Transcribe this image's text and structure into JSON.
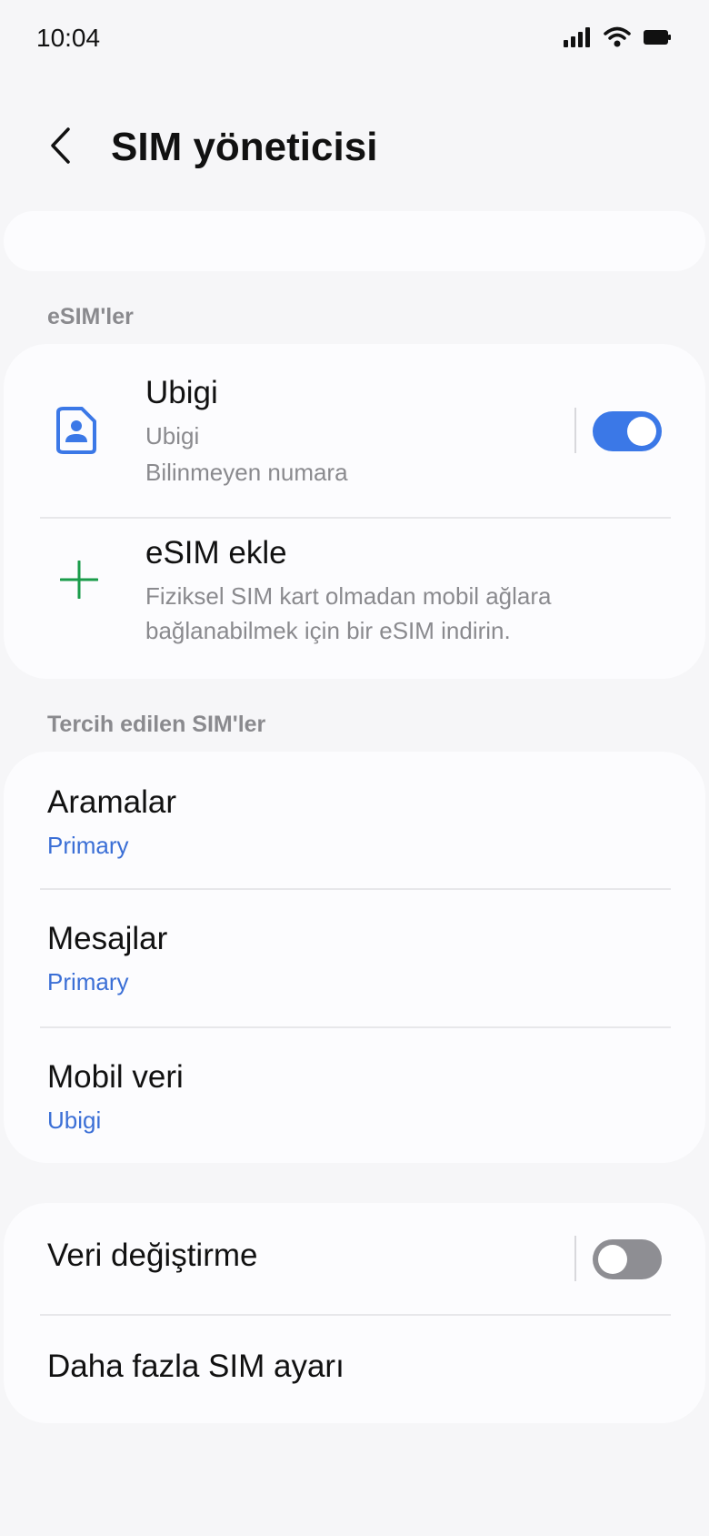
{
  "status_bar": {
    "time": "10:04",
    "icons": [
      "signal-icon",
      "wifi-icon",
      "battery-icon"
    ]
  },
  "header": {
    "title": "SIM yöneticisi",
    "back_icon": "chevron-left-icon"
  },
  "esims": {
    "section_label": "eSIM'ler",
    "items": [
      {
        "title": "Ubigi",
        "line1": "Ubigi",
        "line2": "Bilinmeyen numara",
        "icon": "sim-card-icon",
        "enabled": true
      }
    ],
    "add": {
      "title": "eSIM ekle",
      "desc_line1": "Fiziksel SIM kart olmadan mobil ağlara",
      "desc_line2": "bağlanabilmek için bir eSIM indirin.",
      "icon": "plus-icon"
    }
  },
  "preferred": {
    "section_label": "Tercih edilen SIM'ler",
    "items": [
      {
        "title": "Aramalar",
        "value": "Primary"
      },
      {
        "title": "Mesajlar",
        "value": "Primary"
      },
      {
        "title": "Mobil veri",
        "value": "Ubigi"
      }
    ]
  },
  "other": {
    "data_switch": {
      "title": "Veri değiştirme",
      "enabled": false
    },
    "more": {
      "title": "Daha fazla SIM ayarı"
    }
  },
  "colors": {
    "accent": "#3b78e7",
    "value_text": "#3b6fd6",
    "plus_green": "#1a9c4a",
    "background": "#f6f6f8",
    "card": "#fcfcfe"
  }
}
